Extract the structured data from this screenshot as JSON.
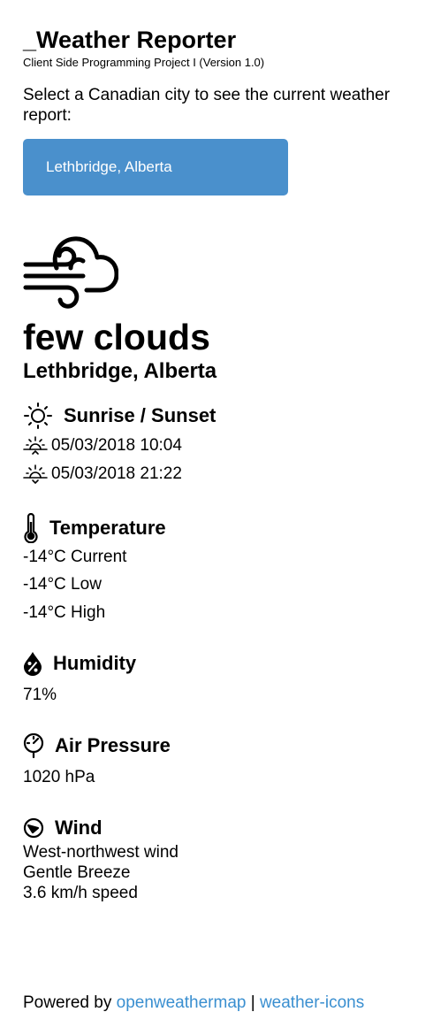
{
  "header": {
    "title": "_Weather Reporter",
    "subtitle": "Client Side Programming Project I (Version 1.0)",
    "intro": "Select a Canadian city to see the current weather report:"
  },
  "city_select": {
    "value": "Lethbridge, Alberta"
  },
  "weather": {
    "icon": "cloud-windy-icon",
    "condition": "few clouds",
    "location": "Lethbridge, Alberta"
  },
  "sun": {
    "heading": "Sunrise / Sunset",
    "sunrise": "05/03/2018 10:04",
    "sunset": "05/03/2018 21:22"
  },
  "temperature": {
    "heading": "Temperature",
    "current": "-14°C Current",
    "low": "-14°C Low",
    "high": "-14°C High"
  },
  "humidity": {
    "heading": "Humidity",
    "value": "71%"
  },
  "pressure": {
    "heading": "Air Pressure",
    "value": "1020 hPa"
  },
  "wind": {
    "heading": "Wind",
    "direction": "West-northwest wind",
    "description": "Gentle Breeze",
    "speed": "3.6 km/h speed"
  },
  "footer": {
    "prefix": "Powered by ",
    "link1": "openweathermap",
    "separator": " | ",
    "link2": "weather-icons"
  }
}
